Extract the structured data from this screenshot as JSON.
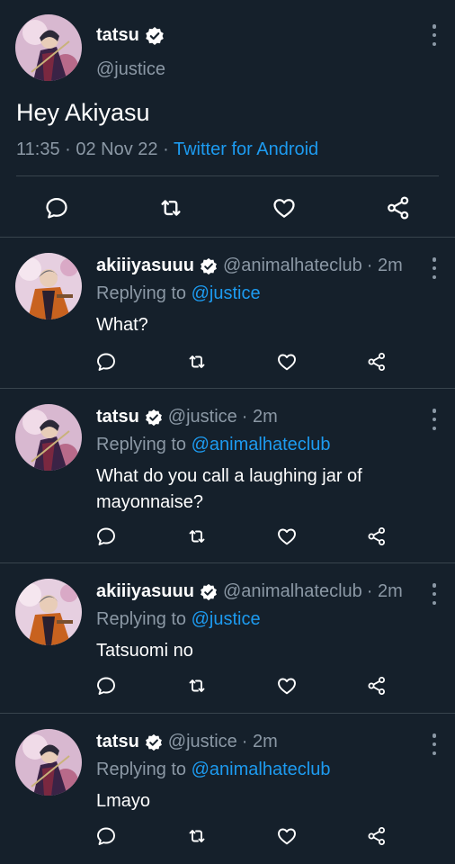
{
  "main_tweet": {
    "name": "tatsu",
    "handle": "@justice",
    "text": "Hey Akiyasu",
    "time": "11:35",
    "date": "02 Nov 22",
    "source": "Twitter for Android",
    "dot": "·",
    "icons": [
      "reply-icon",
      "retweet-icon",
      "like-icon",
      "share-icon"
    ]
  },
  "replies": [
    {
      "name": "akiiiyasuuu",
      "handle": "@animalhateclub",
      "time": "· 2m",
      "replying_prefix": "Replying to ",
      "replying_to": "@justice",
      "text": "What?"
    },
    {
      "name": "tatsu",
      "handle": "@justice",
      "time": "· 2m",
      "replying_prefix": "Replying to ",
      "replying_to": "@animalhateclub",
      "text": "What do you call a laughing jar of mayonnaise?"
    },
    {
      "name": "akiiiyasuuu",
      "handle": "@animalhateclub",
      "time": "· 2m",
      "replying_prefix": "Replying to ",
      "replying_to": "@justice",
      "text": "Tatsuomi no"
    },
    {
      "name": "tatsu",
      "handle": "@justice",
      "time": "· 2m",
      "replying_prefix": "Replying to ",
      "replying_to": "@animalhateclub",
      "text": "Lmayo"
    }
  ],
  "colors": {
    "background": "#15202b",
    "text": "#ffffff",
    "muted": "#8b98a5",
    "link": "#1d9bf0",
    "divider": "#38444d"
  }
}
